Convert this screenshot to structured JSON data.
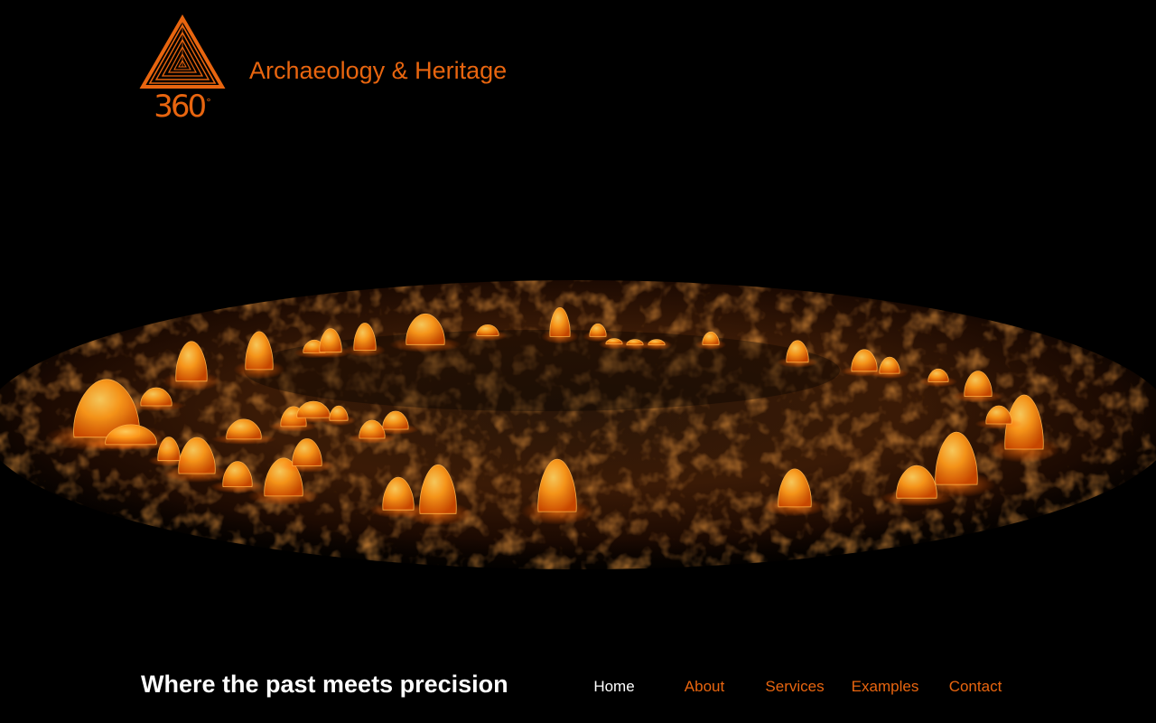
{
  "header": {
    "logo": {
      "text": "360",
      "superscript": "°",
      "icon": "layered-triangle-icon"
    },
    "site_title": "Archaeology & Heritage"
  },
  "hero": {
    "image": "glowing-stone-circle-point-cloud"
  },
  "tagline": "Where the past meets precision",
  "nav": {
    "items": [
      {
        "label": "Home",
        "active": true
      },
      {
        "label": "About",
        "active": false
      },
      {
        "label": "Services",
        "active": false
      },
      {
        "label": "Examples",
        "active": false
      },
      {
        "label": "Contact",
        "active": false
      }
    ]
  },
  "colors": {
    "background": "#000000",
    "accent": "#e8650f",
    "active_nav": "#ffffff",
    "tagline": "#ffffff"
  }
}
